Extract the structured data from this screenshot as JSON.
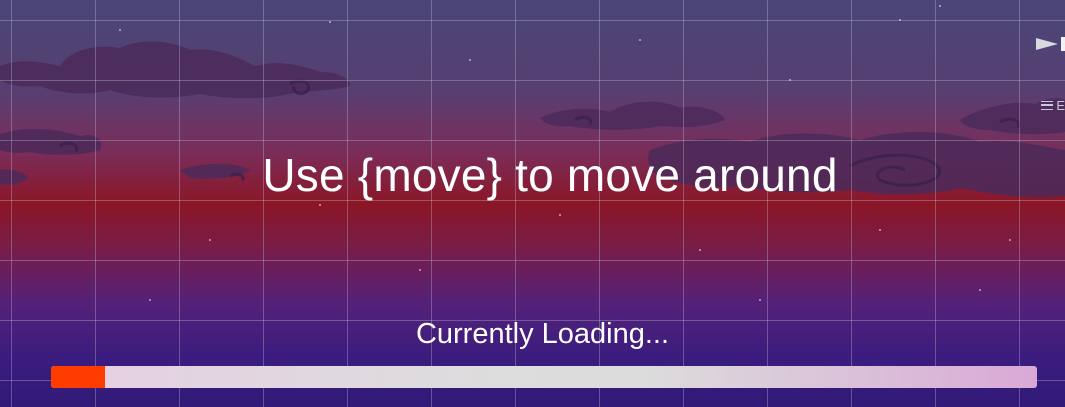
{
  "screen": {
    "prompt_text": "Use {move} to move around",
    "loading_label": "Currently Loading...",
    "progress": 0.055
  },
  "editor_overlay": {
    "menu_label": "E",
    "play_icon": "play-triangle-icon",
    "menu_icon": "hamburger-icon"
  },
  "colors": {
    "progress_fill": "#ff3c00",
    "progress_track": "#dddddd",
    "sky_top": "#4a4678",
    "sky_horizon": "#8b1626",
    "sky_bottom": "#311a78",
    "cloud": "#4b2a5a"
  }
}
